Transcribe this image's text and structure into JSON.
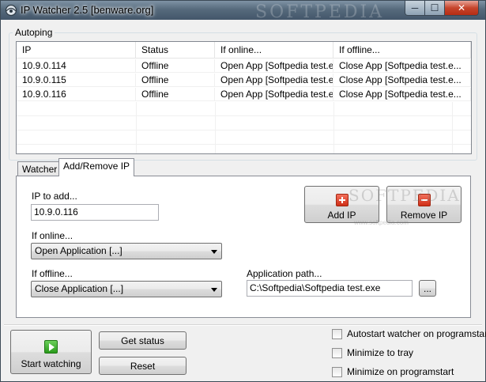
{
  "window": {
    "title": "IP Watcher 2.5 [benware.org]",
    "watermark": "SOFTPEDIA",
    "controls": {
      "minimize": "─",
      "maximize": "☐",
      "close": "✕"
    }
  },
  "autoping": {
    "legend": "Autoping",
    "columns": [
      "IP",
      "Status",
      "If online...",
      "If offline..."
    ],
    "rows": [
      [
        "10.9.0.114",
        "Offline",
        "Open App [Softpedia test.e...",
        "Close App [Softpedia test.e..."
      ],
      [
        "10.9.0.115",
        "Offline",
        "Open App [Softpedia test.e...",
        "Close App [Softpedia test.e..."
      ],
      [
        "10.9.0.116",
        "Offline",
        "Open App [Softpedia test.e...",
        "Close App [Softpedia test.e..."
      ]
    ]
  },
  "tabs": {
    "watcher": "Watcher",
    "add_remove": "Add/Remove IP"
  },
  "form": {
    "ip_label": "IP to add...",
    "ip_value": "10.9.0.116",
    "online_label": "If online...",
    "online_value": "Open Application [...]",
    "offline_label": "If offline...",
    "offline_value": "Close Application [...]",
    "path_label": "Application path...",
    "path_value": "C:\\Softpedia\\Softpedia test.exe",
    "browse_label": "...",
    "add_ip": "Add IP",
    "remove_ip": "Remove IP",
    "panel_watermark": "SOFTPEDIA",
    "panel_watermark_url": "www.softpedia.com"
  },
  "footer": {
    "start_watching": "Start watching",
    "get_status": "Get status",
    "reset": "Reset",
    "autostart": "Autostart watcher on programstart",
    "minimize_tray": "Minimize to tray",
    "minimize_start": "Minimize on programstart"
  },
  "colors": {
    "titlebar": "#566a7c",
    "close_button": "#c6452c",
    "icon_red": "#cf2f17",
    "icon_green": "#2a9a1c"
  },
  "icons": [
    "app-icon",
    "plus-icon",
    "minus-icon",
    "play-icon",
    "chevron-down-icon"
  ]
}
